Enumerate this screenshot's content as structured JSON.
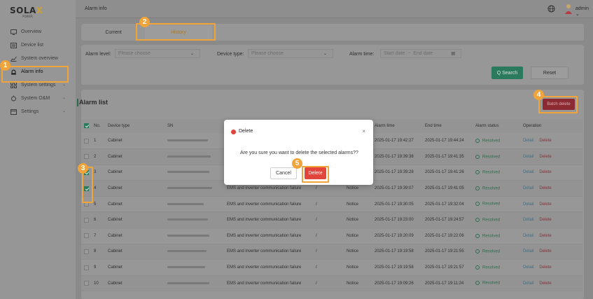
{
  "app": {
    "logo_main": "SOLA",
    "logo_x": "X",
    "logo_sub": "POWER"
  },
  "sidebar": {
    "items": [
      {
        "label": "Overview",
        "icon": "monitor-icon",
        "chevron": false
      },
      {
        "label": "Device list",
        "icon": "list-icon",
        "chevron": false
      },
      {
        "label": "System overview",
        "icon": "chart-icon",
        "chevron": false
      },
      {
        "label": "Alarm info",
        "icon": "alarm-icon",
        "chevron": false,
        "active": true
      },
      {
        "label": "System settings",
        "icon": "grid-icon",
        "chevron": true
      },
      {
        "label": "System O&M",
        "icon": "wrench-icon",
        "chevron": true
      },
      {
        "label": "Settings",
        "icon": "calendar-icon",
        "chevron": true
      }
    ]
  },
  "topbar": {
    "breadcrumb": "Alarm info",
    "user": "admin",
    "user_caret": "⌄"
  },
  "tabs": [
    {
      "label": "Current"
    },
    {
      "label": "History"
    }
  ],
  "filters": {
    "alarm_level_label": "Alarm level:",
    "alarm_level_placeholder": "Please choose",
    "device_type_label": "Device type:",
    "device_type_placeholder": "Please choose",
    "alarm_time_label": "Alarm time:",
    "start_placeholder": "Start date",
    "range_sep": "~",
    "end_placeholder": "End date",
    "search_label": "Q  Search",
    "reset_label": "Reset"
  },
  "list": {
    "title": "Alarm list",
    "batch_delete_label": "Batch delete",
    "columns": [
      "No.",
      "Device type",
      "SN",
      "",
      "",
      "",
      "Alarm time",
      "End time",
      "Alarm status",
      "Operation"
    ],
    "rows": [
      {
        "no": "1",
        "device": "Cabinet",
        "desc": "",
        "val": "",
        "level": "",
        "alarm_time": "2025-01-17 19:42:27",
        "end_time": "2025-01-17 19:44:24",
        "status": "Resolved",
        "checked": false
      },
      {
        "no": "2",
        "device": "Cabinet",
        "desc": "",
        "val": "",
        "level": "",
        "alarm_time": "2025-01-17 19:39:38",
        "end_time": "2025-01-17 19:41:35",
        "status": "Resolved",
        "checked": false
      },
      {
        "no": "3",
        "device": "Cabinet",
        "desc": "",
        "val": "",
        "level": "",
        "alarm_time": "2025-01-17 19:39:28",
        "end_time": "2025-01-17 19:41:26",
        "status": "Resolved",
        "checked": true
      },
      {
        "no": "4",
        "device": "Cabinet",
        "desc": "EMS and inverter communication failure",
        "val": "/",
        "level": "Notice",
        "alarm_time": "2025-01-17 19:39:07",
        "end_time": "2025-01-17 19:41:05",
        "status": "Resolved",
        "checked": true
      },
      {
        "no": "5",
        "device": "Cabinet",
        "desc": "EMS and inverter communication failure",
        "val": "/",
        "level": "Notice",
        "alarm_time": "2025-01-17 19:30:05",
        "end_time": "2025-01-17 19:32:04",
        "status": "Resolved",
        "checked": false
      },
      {
        "no": "6",
        "device": "Cabinet",
        "desc": "EMS and inverter communication failure",
        "val": "/",
        "level": "Notice",
        "alarm_time": "2025-01-17 19:23:00",
        "end_time": "2025-01-17 19:24:57",
        "status": "Resolved",
        "checked": false
      },
      {
        "no": "7",
        "device": "Cabinet",
        "desc": "EMS and inverter communication failure",
        "val": "/",
        "level": "Notice",
        "alarm_time": "2025-01-17 19:20:09",
        "end_time": "2025-01-17 19:22:06",
        "status": "Resolved",
        "checked": false
      },
      {
        "no": "8",
        "device": "Cabinet",
        "desc": "EMS and inverter communication failure",
        "val": "/",
        "level": "Notice",
        "alarm_time": "2025-01-17 19:19:58",
        "end_time": "2025-01-17 19:21:55",
        "status": "Resolved",
        "checked": false
      },
      {
        "no": "9",
        "device": "Cabinet",
        "desc": "EMS and inverter communication failure",
        "val": "/",
        "level": "Notice",
        "alarm_time": "2025-01-17 19:19:58",
        "end_time": "2025-01-17 19:21:57",
        "status": "Resolved",
        "checked": false
      },
      {
        "no": "10",
        "device": "Cabinet",
        "desc": "EMS and inverter communication failure",
        "val": "/",
        "level": "Notice",
        "alarm_time": "2025-01-17 19:09:26",
        "end_time": "2025-01-17 19:11:24",
        "status": "Resolved",
        "checked": false
      }
    ],
    "op_detail": "Detail",
    "op_delete": "Delete"
  },
  "modal": {
    "title": "Delete",
    "close": "×",
    "message": "Are you sure you want to delete the selected alarms??",
    "cancel_label": "Cancel",
    "delete_label": "Delete"
  },
  "annotations": [
    "1",
    "2",
    "3",
    "4",
    "5"
  ],
  "colors": {
    "highlight": "#f0a43a",
    "accent": "#2b7a5d",
    "danger": "#e1453c"
  }
}
